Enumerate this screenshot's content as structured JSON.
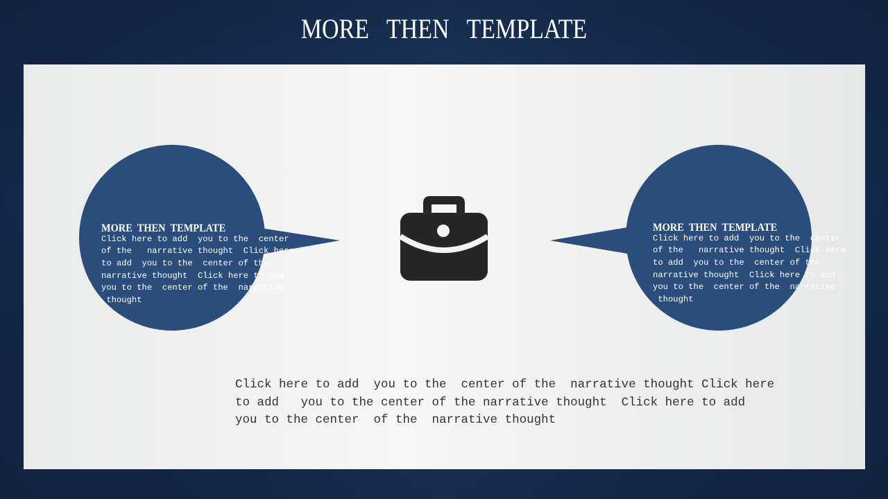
{
  "slide_title": "MORE   THEN   TEMPLATE",
  "left_bubble": {
    "title": "MORE  THEN  TEMPLATE",
    "body": "Click here to add  you to the  center\nof the   narrative thought  Click here\nto add  you to the  center of the\nnarrative thought  Click here to add\nyou to the  center of the  narrative\n thought"
  },
  "right_bubble": {
    "title": "MORE  THEN  TEMPLATE",
    "body": "Click here to add  you to the  center\nof the   narrative thought  Click here\nto add  you to the  center of the\nnarrative thought  Click here to add\nyou to the  center of the  narrative\n thought"
  },
  "center_icon": "briefcase-icon",
  "bottom_text": "Click here to add  you to the  center of the  narrative thought Click here\nto add   you to the center of the narrative thought  Click here to add\nyou to the center  of the  narrative thought",
  "colors": {
    "accent": "#2a4d7b",
    "background": "#1d3a62",
    "panel": "#f3f4f4",
    "icon": "#262626"
  }
}
